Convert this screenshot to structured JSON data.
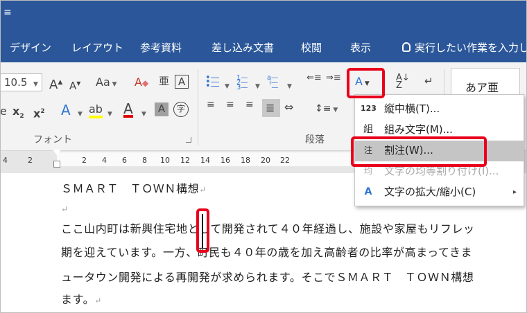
{
  "titlebar": {
    "qat_glyph": "≡"
  },
  "tabs": [
    {
      "label": "デザイン"
    },
    {
      "label": "レイアウト"
    },
    {
      "label": "参考資料"
    },
    {
      "label": "差し込み文書"
    },
    {
      "label": "校閲"
    },
    {
      "label": "表示"
    }
  ],
  "tell_me": {
    "text": "実行したい作業を入力し"
  },
  "font": {
    "size_value": "10.5",
    "grow_glyph": "A",
    "shrink_glyph": "A",
    "case_glyph": "Aa",
    "clear_glyph": "A",
    "phonetic_glyph": "亜",
    "border_glyph": "A",
    "strike_glyph": "ab",
    "subscript_glyph": "x",
    "superscript_glyph": "x",
    "effects_glyph": "A",
    "highlight_glyph": "ab",
    "color_glyph": "A",
    "shading_glyph": "A",
    "enclose_glyph": "字",
    "group_label": "フォント"
  },
  "paragraph": {
    "group_label": "段落",
    "numbering_glyph": "123"
  },
  "styles": {
    "sample_text": "あア亜"
  },
  "ruler": {
    "ticks": [
      "4",
      "2",
      "2",
      "4",
      "6",
      "8",
      "10",
      "12",
      "14",
      "16",
      "18",
      "20",
      "22"
    ]
  },
  "document": {
    "lines": [
      "ＳＭＡＲＴ　ＴＯＷＮ構想",
      "",
      "ここ山内町は新興住宅地として開発されて４０年経過し、施設や家屋もリフレッ",
      "期を迎えています。一方、町民も４０年の歳を加え高齢者の比率が高まってきま",
      "ュータウン開発による再開発が求められます。そこでＳＭＡＲＴ　ＴＯＷＮ構想",
      "ます。"
    ],
    "para_mark": "↵"
  },
  "menu": {
    "items": [
      {
        "icon": "123",
        "label": "縦中横(T)...",
        "disabled": false
      },
      {
        "icon": "組",
        "label": "組み文字(M)...",
        "disabled": false
      },
      {
        "icon": "注",
        "label": "割注(W)...",
        "disabled": false
      },
      {
        "icon": "均",
        "label": "文字の均等割り付け(I)...",
        "disabled": true
      },
      {
        "icon": "A",
        "label": "文字の拡大/縮小(C)",
        "disabled": false
      }
    ],
    "submenu_arrow": "▸"
  },
  "colors": {
    "accent": "#2b579a",
    "highlight": "#e8001c",
    "effects_blue": "#2e74d4",
    "font_red": "#e00000",
    "marker_yellow": "#ffff00"
  }
}
